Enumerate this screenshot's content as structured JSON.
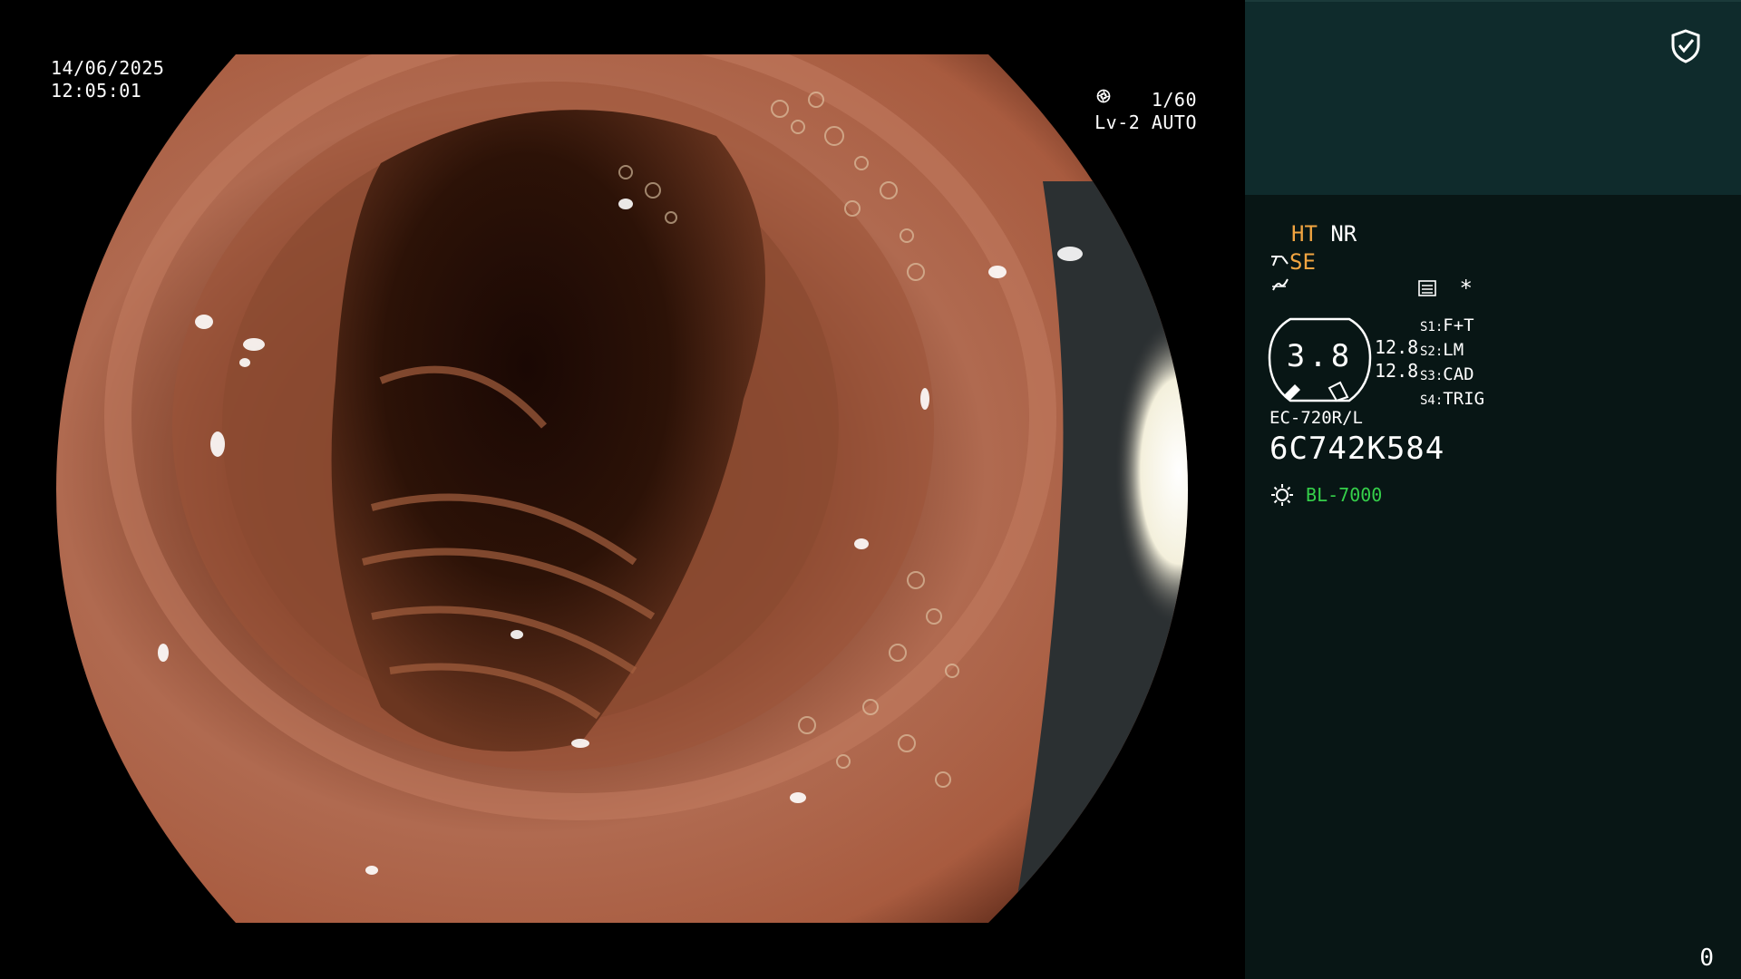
{
  "overlay": {
    "date": "14/06/2025",
    "time": "12:05:01",
    "shutter": "1/60",
    "iris": "Lv-2 AUTO"
  },
  "panel": {
    "mode_ht": "HT",
    "mode_nr": "NR",
    "mode_se": "SE",
    "star": "*",
    "gauge_value": "3.8",
    "gauge_side_values": [
      "12.8",
      "12.8"
    ],
    "presets": [
      {
        "key": "S1:",
        "value": "F+T"
      },
      {
        "key": "S2:",
        "value": "LM"
      },
      {
        "key": "S3:",
        "value": "CAD"
      },
      {
        "key": "S4:",
        "value": "TRIG"
      }
    ],
    "scope_model": "EC-720R/L",
    "scope_serial": "6C742K584",
    "light_source": "BL-7000",
    "counter": "0"
  },
  "colors": {
    "panel_top": "#0f2b2c",
    "panel_bottom": "#081615",
    "accent_orange": "#f2a541",
    "accent_green": "#35d04a"
  },
  "icons": [
    "shield-check-icon",
    "shutter-icon",
    "iris-icon",
    "scope-angle-icon",
    "flash-icon",
    "menu-icon",
    "light-source-icon"
  ]
}
